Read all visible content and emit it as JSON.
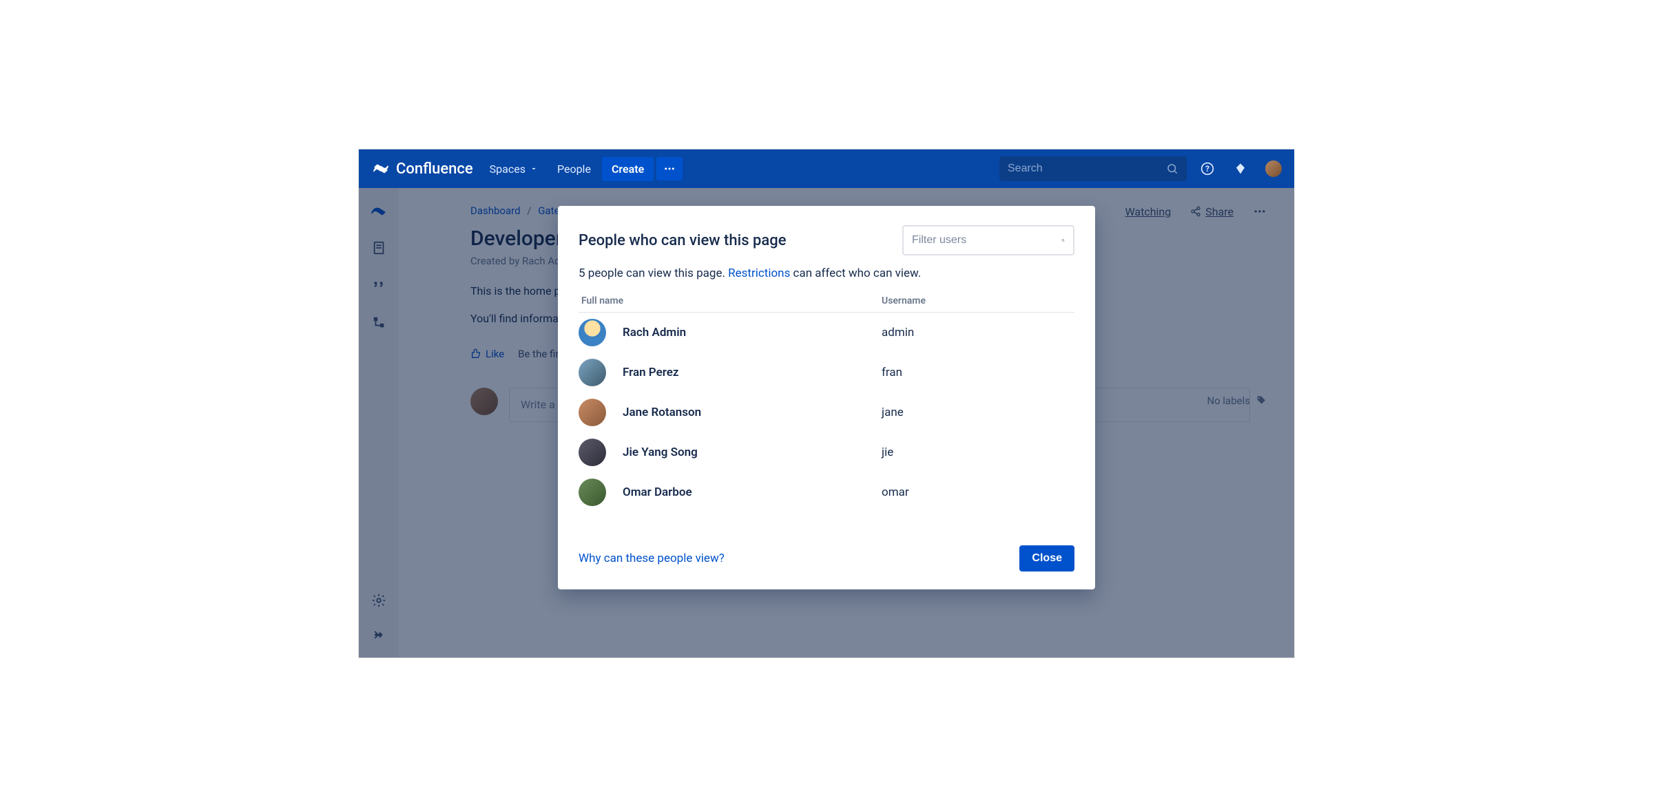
{
  "brand": "Confluence",
  "nav": {
    "spaces": "Spaces",
    "people": "People",
    "create": "Create"
  },
  "search": {
    "placeholder": "Search"
  },
  "breadcrumb": {
    "dashboard": "Dashboard",
    "space": "Gatek…"
  },
  "page": {
    "title": "Developers",
    "byline": "Created by Rach Admin,",
    "para1": "This is the home page of the Developers space. It holds the roadmap and team calendar.",
    "para2": "You'll find informatio…",
    "like": "Like",
    "be_first": "Be the first t…",
    "no_labels": "No labels",
    "comment_placeholder": "Write a com…",
    "watching": "Watching",
    "share": "Share"
  },
  "modal": {
    "title": "People who can view this page",
    "filter_placeholder": "Filter users",
    "sub_prefix": "5 people can view this page. ",
    "restrictions": "Restrictions",
    "sub_suffix": " can affect who can view.",
    "th_fullname": "Full name",
    "th_username": "Username",
    "users": [
      {
        "fullname": "Rach Admin",
        "username": "admin"
      },
      {
        "fullname": "Fran Perez",
        "username": "fran"
      },
      {
        "fullname": "Jane Rotanson",
        "username": "jane"
      },
      {
        "fullname": "Jie Yang Song",
        "username": "jie"
      },
      {
        "fullname": "Omar Darboe",
        "username": "omar"
      }
    ],
    "why_link": "Why can these people view?",
    "close": "Close"
  }
}
